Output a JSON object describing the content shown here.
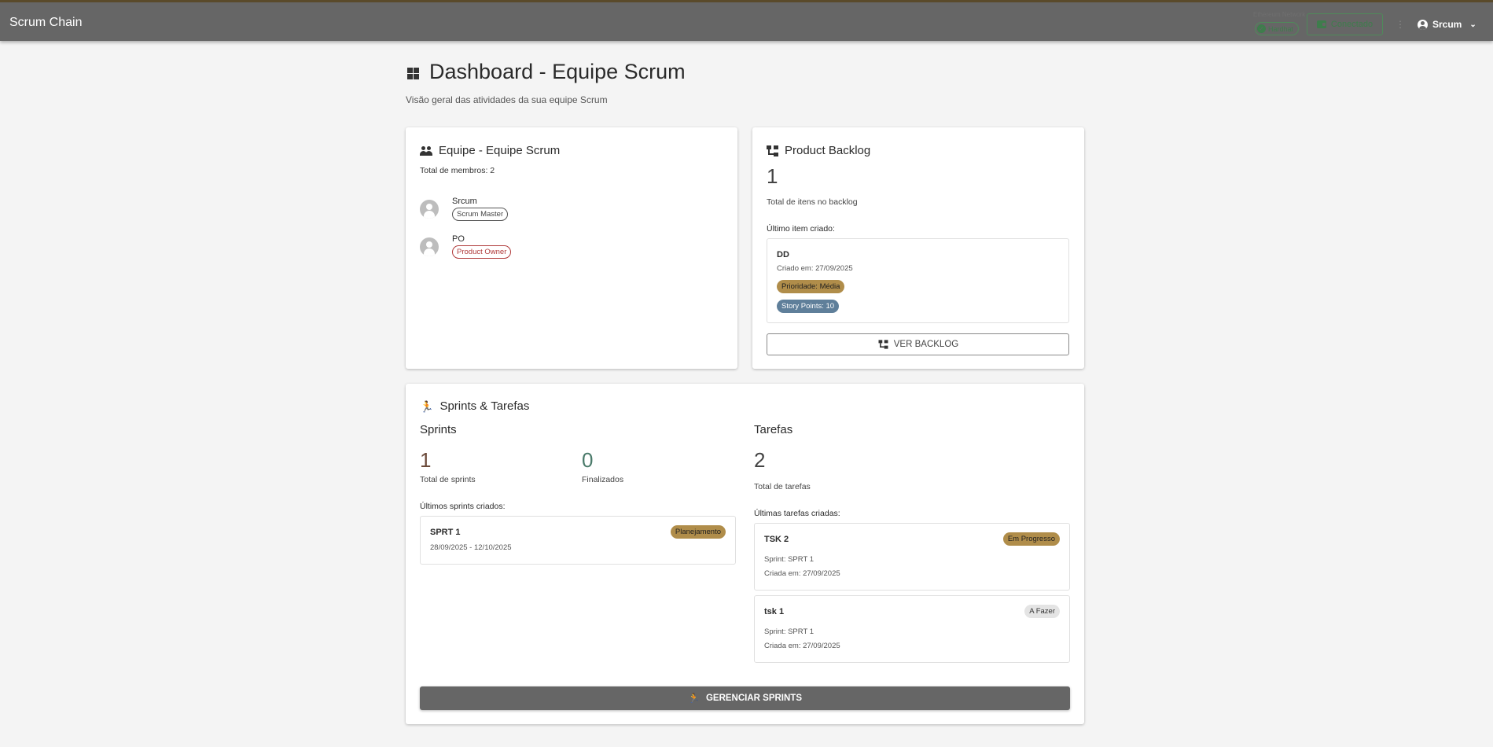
{
  "header": {
    "app_title": "Scrum Chain",
    "network_label": "Ethereum Network",
    "network_chip": "Hardhat",
    "connect_label": "Conectado",
    "user_name": "Srcum"
  },
  "page": {
    "title": "Dashboard - Equipe Scrum",
    "subtitle": "Visão geral das atividades da sua equipe Scrum"
  },
  "team": {
    "title": "Equipe - Equipe Scrum",
    "total_label": "Total de membros: 2",
    "members": [
      {
        "name": "Srcum",
        "role": "Scrum Master",
        "role_color": "#444444"
      },
      {
        "name": "PO",
        "role": "Product Owner",
        "role_color": "#b03a3a"
      }
    ]
  },
  "backlog": {
    "title": "Product Backlog",
    "total": "1",
    "total_label": "Total de itens no backlog",
    "last_label": "Último item criado:",
    "last_item": {
      "title": "DD",
      "created": "Criado em: 27/09/2025",
      "priority": "Prioridade: Média",
      "story_points": "Story Points: 10"
    },
    "view_button": "VER BACKLOG"
  },
  "sprints_tasks": {
    "title": "Sprints & Tarefas",
    "sprints": {
      "heading": "Sprints",
      "total": "1",
      "total_label": "Total de sprints",
      "finished": "0",
      "finished_label": "Finalizados",
      "last_label": "Últimos sprints criados:",
      "items": [
        {
          "title": "SPRT 1",
          "dates": "28/09/2025 - 12/10/2025",
          "status": "Planejamento"
        }
      ]
    },
    "tasks": {
      "heading": "Tarefas",
      "total": "2",
      "total_label": "Total de tarefas",
      "last_label": "Últimas tarefas criadas:",
      "items": [
        {
          "title": "TSK 2",
          "sprint": "Sprint: SPRT 1",
          "created": "Criada em: 27/09/2025",
          "status": "Em Progresso"
        },
        {
          "title": "tsk 1",
          "sprint": "Sprint: SPRT 1",
          "created": "Criada em: 27/09/2025",
          "status": "A Fazer"
        }
      ]
    },
    "manage_button": "GERENCIAR SPRINTS"
  },
  "colors": {
    "topbar": "#666666",
    "accent_gold": "#b08d4a",
    "accent_blue": "#5f7f9a",
    "success_green": "#3e7d4c",
    "finished_teal": "#4a7a6a",
    "sprint_num": "#6b4a3a"
  },
  "icons": [
    "dashboard-icon",
    "team-icon",
    "account-tree-icon",
    "run-icon",
    "wallet-icon",
    "account-circle-icon",
    "chevron-down-icon",
    "check-circle-icon",
    "avatar-person-icon"
  ]
}
